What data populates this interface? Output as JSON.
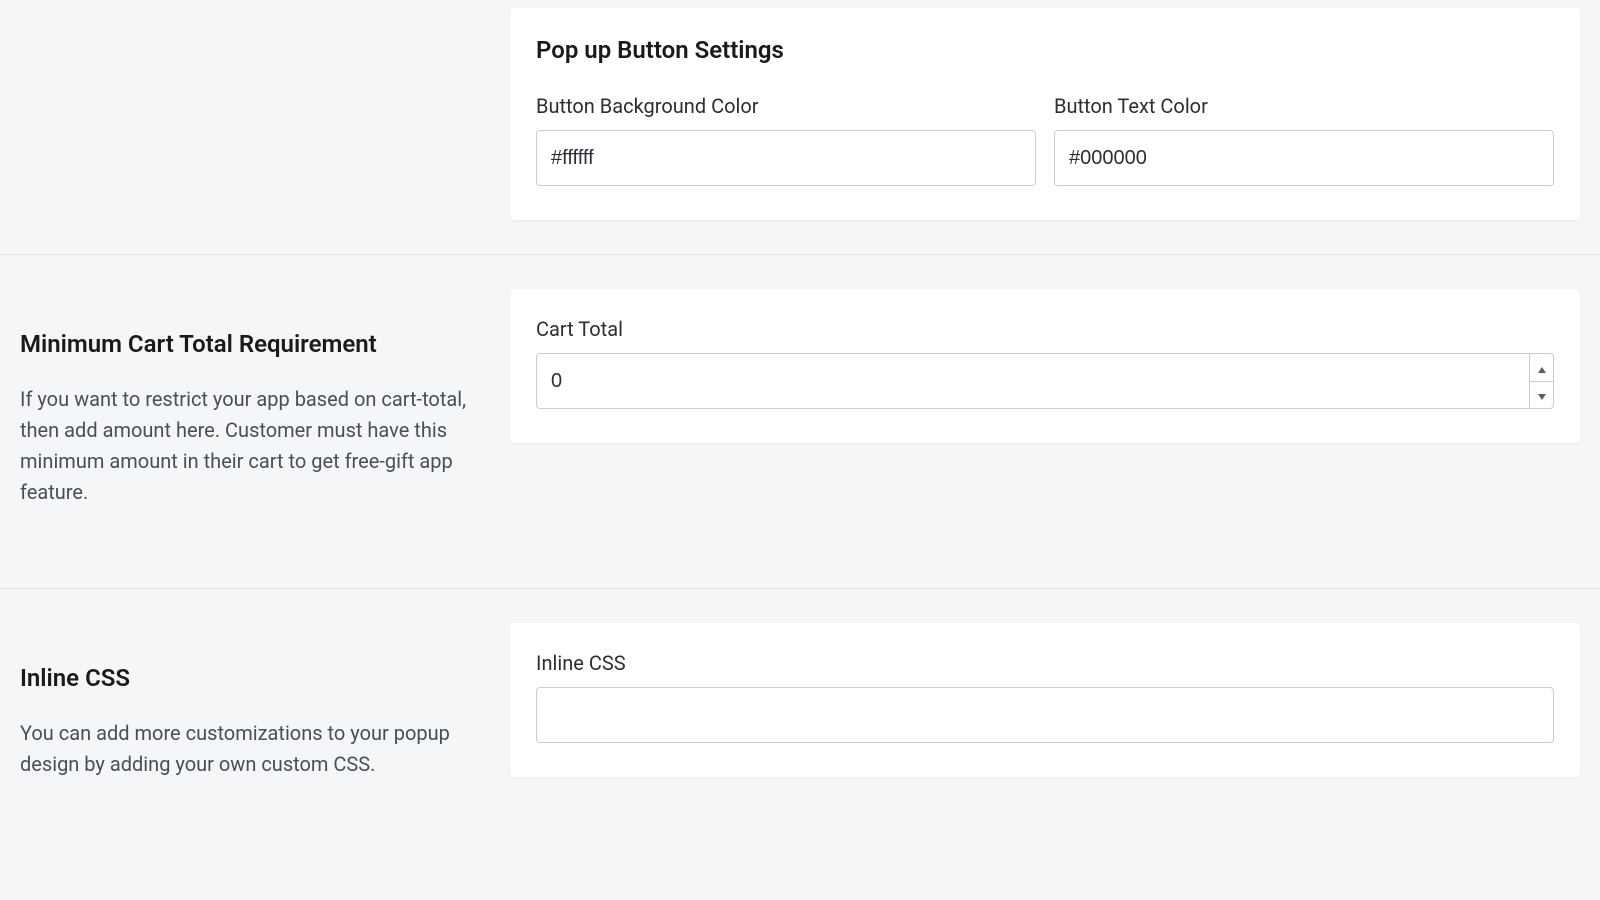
{
  "popup_button": {
    "title": "Pop up Button Settings",
    "bg_color": {
      "label": "Button Background Color",
      "value": "#ffffff"
    },
    "text_color": {
      "label": "Button Text Color",
      "value": "#000000"
    }
  },
  "min_cart": {
    "heading": "Minimum Cart Total Requirement",
    "desc": "If you want to restrict your app based on cart-total, then add amount here. Customer must have this minimum amount in their cart to get free-gift app feature.",
    "field_label": "Cart Total",
    "value": "0"
  },
  "inline_css": {
    "heading": "Inline CSS",
    "desc": "You can add more customizations to your popup design by adding your own custom CSS.",
    "field_label": "Inline CSS",
    "value": ""
  }
}
